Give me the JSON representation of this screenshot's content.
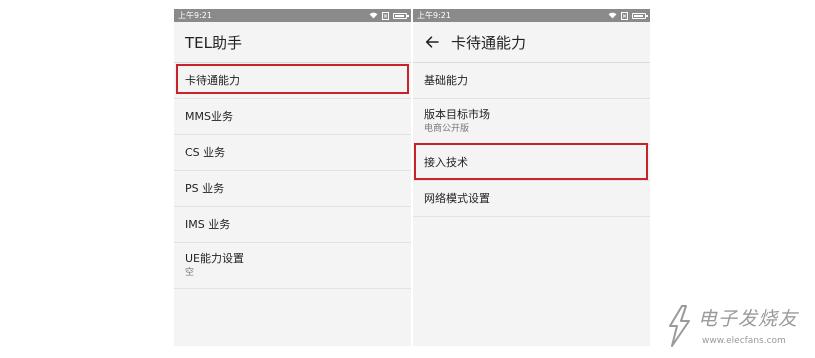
{
  "left_screen": {
    "status_time": "上午9:21",
    "title": "TEL助手",
    "items": [
      {
        "label": "卡待通能力",
        "sub": ""
      },
      {
        "label": "MMS业务",
        "sub": ""
      },
      {
        "label": "CS 业务",
        "sub": ""
      },
      {
        "label": "PS 业务",
        "sub": ""
      },
      {
        "label": "IMS 业务",
        "sub": ""
      },
      {
        "label": "UE能力设置",
        "sub": "空"
      }
    ],
    "highlighted_item": "卡待通能力"
  },
  "right_screen": {
    "status_time": "上午9:21",
    "title": "卡待通能力",
    "items": [
      {
        "label": "基础能力",
        "sub": ""
      },
      {
        "label": "版本目标市场",
        "sub": "电商公开版"
      },
      {
        "label": "接入技术",
        "sub": ""
      },
      {
        "label": "网络模式设置",
        "sub": ""
      }
    ],
    "highlighted_item": "接入技术"
  },
  "watermark": {
    "text": "电子发烧友",
    "url": "www.elecfans.com"
  },
  "colors": {
    "status_bar": "#8a8a8a",
    "screen_background": "#f4f4f4",
    "highlight": "#c8232a"
  },
  "icons": [
    "wifi-icon",
    "sim-icon",
    "battery-icon",
    "arrow-left-icon"
  ]
}
